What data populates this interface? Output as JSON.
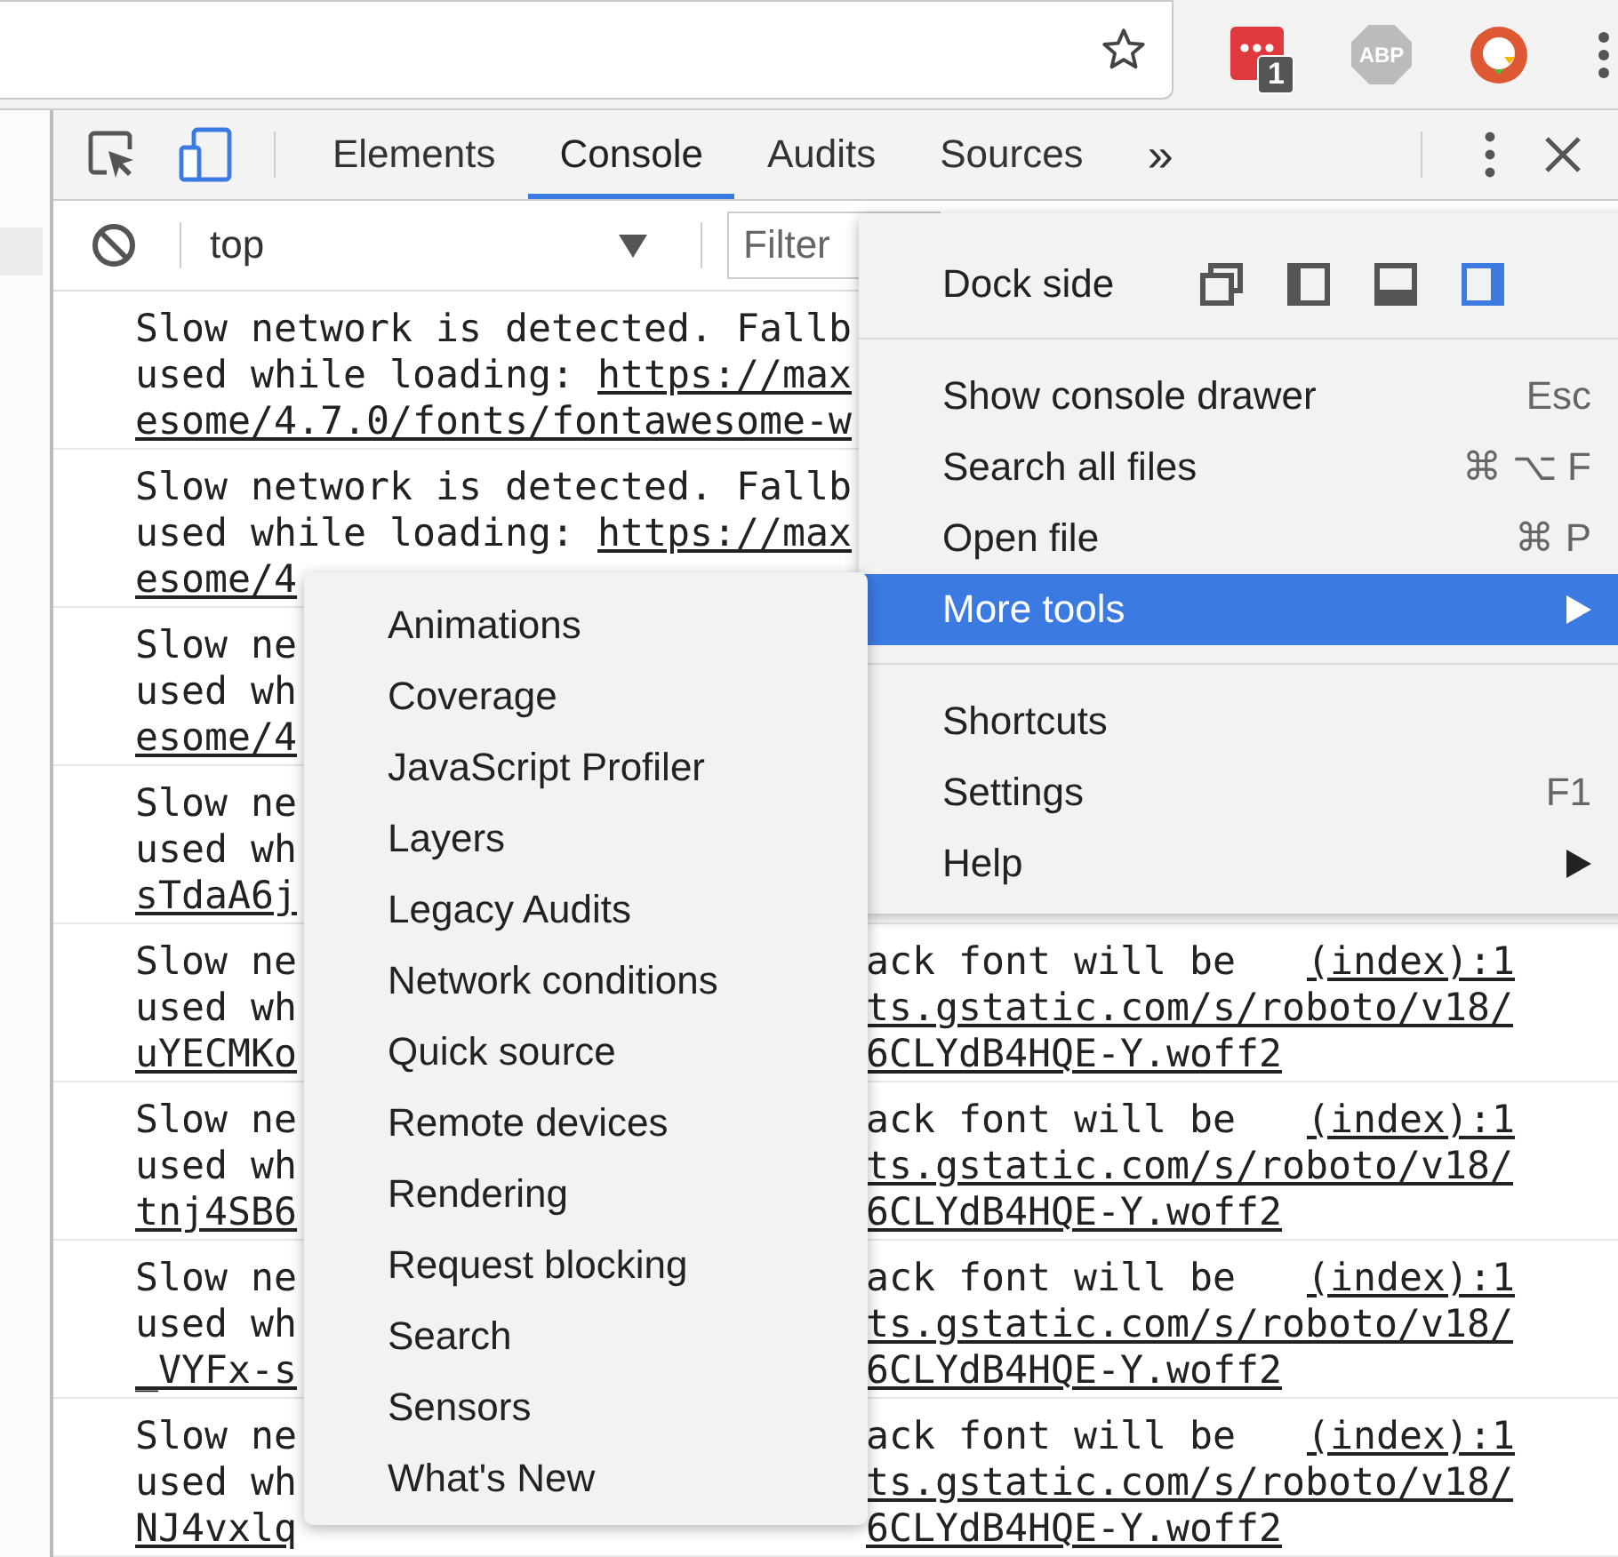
{
  "browser": {
    "extension_badge": "1",
    "abp_label": "ABP",
    "bookmarked": false
  },
  "devtools": {
    "tabs": [
      {
        "label": "Elements",
        "selected": false
      },
      {
        "label": "Console",
        "selected": true
      },
      {
        "label": "Audits",
        "selected": false
      },
      {
        "label": "Sources",
        "selected": false
      }
    ],
    "overflow": "»"
  },
  "console_toolbar": {
    "context": "top",
    "filter_placeholder": "Filter"
  },
  "messages": [
    {
      "lines": [
        {
          "text": "Slow network is detected. Fallb"
        },
        {
          "text": "used while loading: ",
          "link": "https://max"
        },
        {
          "link": "esome/4.7.0/fonts/fontawesome-w"
        }
      ]
    },
    {
      "lines": [
        {
          "text": "Slow network is detected. Fallb"
        },
        {
          "text": "used while loading: ",
          "link": "https://max"
        },
        {
          "link": "esome/4"
        }
      ]
    },
    {
      "lines": [
        {
          "text": "Slow ne"
        },
        {
          "text": "used wh"
        },
        {
          "link": "esome/4"
        }
      ]
    },
    {
      "lines": [
        {
          "text": "Slow ne"
        },
        {
          "text": "used wh"
        },
        {
          "link": "sTdaA6j"
        }
      ]
    },
    {
      "lines": [
        {
          "text": "Slow ne",
          "right": {
            "text": "ack font will be",
            "source": "(index):1"
          }
        },
        {
          "text": "used wh",
          "right": {
            "link": "ts.gstatic.com/s/roboto/v18/"
          }
        },
        {
          "link": "uYECMKo",
          "right": {
            "link": "6CLYdB4HQE-Y.woff2"
          }
        }
      ]
    },
    {
      "lines": [
        {
          "text": "Slow ne",
          "right": {
            "text": "ack font will be",
            "source": "(index):1"
          }
        },
        {
          "text": "used wh",
          "right": {
            "link": "ts.gstatic.com/s/roboto/v18/"
          }
        },
        {
          "link": "tnj4SB6",
          "right": {
            "link": "6CLYdB4HQE-Y.woff2"
          }
        }
      ]
    },
    {
      "lines": [
        {
          "text": "Slow ne",
          "right": {
            "text": "ack font will be",
            "source": "(index):1"
          }
        },
        {
          "text": "used wh",
          "right": {
            "link": "ts.gstatic.com/s/roboto/v18/"
          }
        },
        {
          "link": "_VYFx-s",
          "right": {
            "link": "6CLYdB4HQE-Y.woff2"
          }
        }
      ]
    },
    {
      "lines": [
        {
          "text": "Slow ne",
          "right": {
            "text": "ack font will be",
            "source": "(index):1"
          }
        },
        {
          "text": "used wh",
          "right": {
            "link": "ts.gstatic.com/s/roboto/v18/"
          }
        },
        {
          "link": "NJ4vxlq",
          "right": {
            "link": "6CLYdB4HQE-Y.woff2"
          }
        }
      ]
    }
  ],
  "main_menu": {
    "dock_side": {
      "label": "Dock side",
      "options": [
        {
          "kind": "undock",
          "selected": false
        },
        {
          "kind": "left",
          "selected": false
        },
        {
          "kind": "bottom",
          "selected": false
        },
        {
          "kind": "right",
          "selected": true
        }
      ]
    },
    "groups": [
      [
        {
          "label": "Show console drawer",
          "shortcut": "Esc",
          "selected": false,
          "submenu": false
        },
        {
          "label": "Search all files",
          "shortcut": "⌘ ⌥ F",
          "selected": false,
          "submenu": false
        },
        {
          "label": "Open file",
          "shortcut": "⌘ P",
          "selected": false,
          "submenu": false
        },
        {
          "label": "More tools",
          "selected": true,
          "submenu": true
        }
      ],
      [
        {
          "label": "Shortcuts",
          "selected": false,
          "submenu": false
        },
        {
          "label": "Settings",
          "shortcut": "F1",
          "selected": false,
          "submenu": false
        },
        {
          "label": "Help",
          "selected": false,
          "submenu": true
        }
      ]
    ]
  },
  "more_tools_menu": [
    {
      "label": "Animations"
    },
    {
      "label": "Coverage"
    },
    {
      "label": "JavaScript Profiler"
    },
    {
      "label": "Layers"
    },
    {
      "label": "Legacy Audits"
    },
    {
      "label": "Network conditions"
    },
    {
      "label": "Quick source"
    },
    {
      "label": "Remote devices"
    },
    {
      "label": "Rendering"
    },
    {
      "label": "Request blocking"
    },
    {
      "label": "Search"
    },
    {
      "label": "Sensors"
    },
    {
      "label": "What's New"
    }
  ]
}
